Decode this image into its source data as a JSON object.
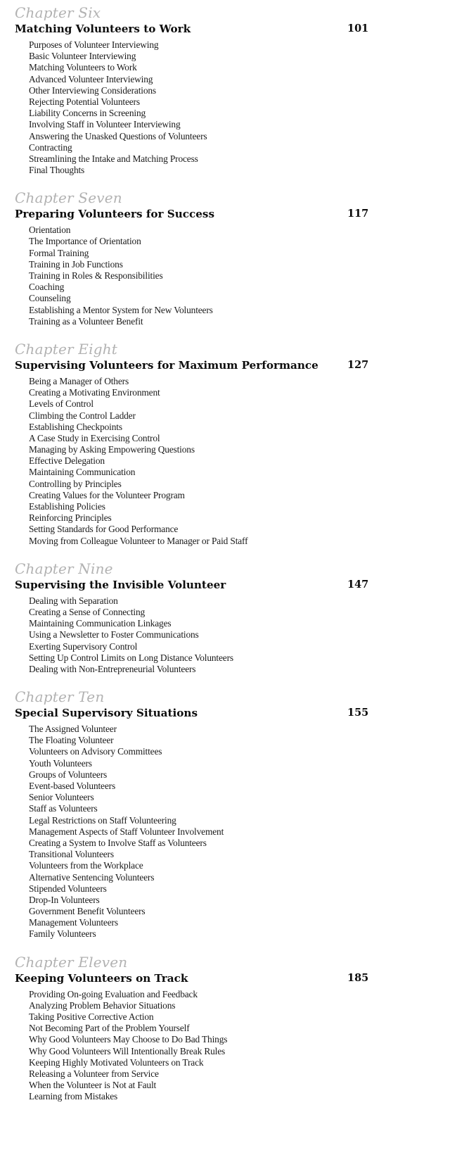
{
  "toc": {
    "chapters": [
      {
        "label": "Chapter Six",
        "title": "Matching Volunteers to Work",
        "page": "101",
        "sections": [
          "Purposes of Volunteer Interviewing",
          "Basic Volunteer Interviewing",
          "Matching Volunteers to Work",
          "Advanced Volunteer Interviewing",
          "Other Interviewing Considerations",
          "Rejecting Potential Volunteers",
          "Liability Concerns in Screening",
          "Involving Staff in Volunteer Interviewing",
          "Answering the Unasked Questions of Volunteers",
          "Contracting",
          "Streamlining the Intake and Matching Process",
          "Final Thoughts"
        ]
      },
      {
        "label": "Chapter Seven",
        "title": "Preparing Volunteers for Success",
        "page": "117",
        "sections": [
          "Orientation",
          "The Importance of Orientation",
          "Formal Training",
          "Training in Job Functions",
          "Training in Roles & Responsibilities",
          "Coaching",
          "Counseling",
          "Establishing a Mentor System for New Volunteers",
          "Training as a Volunteer Benefit"
        ]
      },
      {
        "label": "Chapter Eight",
        "title": "Supervising Volunteers for Maximum Performance",
        "page": "127",
        "sections": [
          "Being a Manager of Others",
          "Creating a Motivating Environment",
          "Levels of Control",
          "Climbing the Control Ladder",
          "Establishing Checkpoints",
          "A Case Study in Exercising Control",
          "Managing by Asking Empowering Questions",
          "Effective Delegation",
          "Maintaining Communication",
          "Controlling by Principles",
          "Creating Values for the Volunteer Program",
          "Establishing Policies",
          "Reinforcing Principles",
          "Setting Standards for Good Performance",
          "Moving from Colleague Volunteer to Manager or Paid Staff"
        ]
      },
      {
        "label": "Chapter Nine",
        "title": "Supervising the Invisible Volunteer",
        "page": "147",
        "sections": [
          "Dealing with Separation",
          "Creating a Sense of Connecting",
          "Maintaining Communication Linkages",
          "Using a Newsletter to Foster Communications",
          "Exerting Supervisory Control",
          "Setting Up Control Limits on Long Distance Volunteers",
          "Dealing with Non-Entrepreneurial Volunteers"
        ]
      },
      {
        "label": "Chapter Ten",
        "title": "Special Supervisory Situations",
        "page": "155",
        "sections": [
          "The Assigned Volunteer",
          "The Floating Volunteer",
          "Volunteers on Advisory Committees",
          "Youth Volunteers",
          "Groups of Volunteers",
          "Event-based Volunteers",
          "Senior Volunteers",
          "Staff as Volunteers",
          "Legal Restrictions on Staff Volunteering",
          "Management Aspects of Staff Volunteer Involvement",
          "Creating a System to Involve Staff as Volunteers",
          "Transitional Volunteers",
          "Volunteers from the Workplace",
          "Alternative Sentencing Volunteers",
          "Stipended Volunteers",
          "Drop-In Volunteers",
          "Government Benefit Volunteers",
          "Management Volunteers",
          "Family Volunteers"
        ]
      },
      {
        "label": "Chapter Eleven",
        "title": "Keeping Volunteers on Track",
        "page": "185",
        "sections": [
          "Providing On-going Evaluation and Feedback",
          "Analyzing Problem Behavior Situations",
          "Taking Positive Corrective Action",
          "Not Becoming Part of the Problem Yourself",
          "Why Good Volunteers May Choose to Do Bad Things",
          "Why Good Volunteers Will Intentionally Break Rules",
          "Keeping Highly Motivated Volunteers on Track",
          "Releasing a Volunteer from Service",
          "When the Volunteer is Not at Fault",
          "Learning from Mistakes"
        ]
      }
    ]
  }
}
